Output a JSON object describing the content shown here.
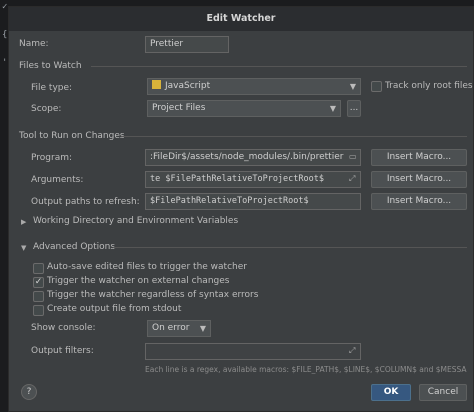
{
  "dialog": {
    "title": "Edit Watcher",
    "name_label": "Name:",
    "name_value": "Prettier"
  },
  "files_to_watch": {
    "section": "Files to Watch",
    "file_type_label": "File type:",
    "file_type_value": "JavaScript",
    "track_root_label": "Track only root files",
    "track_root_checked": false,
    "scope_label": "Scope:",
    "scope_value": "Project Files",
    "scope_more": "..."
  },
  "tool": {
    "section": "Tool to Run on Changes",
    "program_label": "Program:",
    "program_value": ":FileDir$/assets/node_modules/.bin/prettier",
    "arguments_label": "Arguments:",
    "arguments_value": "te $FilePathRelativeToProjectRoot$",
    "output_paths_label": "Output paths to refresh:",
    "output_paths_value": "$FilePathRelativeToProjectRoot$",
    "insert_macro": "Insert Macro...",
    "working_dir_label": "Working Directory and Environment Variables"
  },
  "advanced": {
    "section": "Advanced Options",
    "options": [
      {
        "label": "Auto-save edited files to trigger the watcher",
        "checked": false
      },
      {
        "label": "Trigger the watcher on external changes",
        "checked": true
      },
      {
        "label": "Trigger the watcher regardless of syntax errors",
        "checked": false
      },
      {
        "label": "Create output file from stdout",
        "checked": false
      }
    ],
    "show_console_label": "Show console:",
    "show_console_value": "On error",
    "output_filters_label": "Output filters:",
    "output_filters_value": "",
    "hint": "Each line is a regex, available macros: $FILE_PATH$, $LINE$, $COLUMN$ and $MESSA..."
  },
  "buttons": {
    "help": "?",
    "ok": "OK",
    "cancel": "Cancel"
  },
  "editor_bg": {
    "glyph1": "✓",
    "glyph2": "{",
    "glyph3": "'"
  },
  "icons": {
    "browse": "folder-icon",
    "expand": "expand-icon",
    "dropdown": "chevron-down-icon"
  }
}
